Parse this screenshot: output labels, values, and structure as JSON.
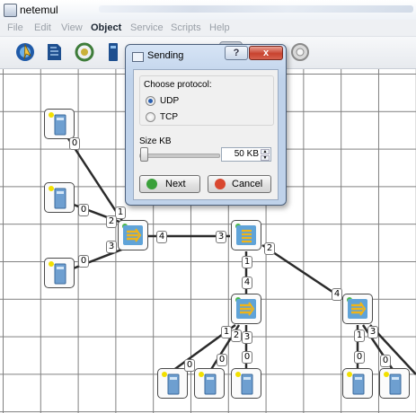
{
  "window": {
    "title": "netemul"
  },
  "menu": {
    "items": [
      {
        "label": "File",
        "active": false
      },
      {
        "label": "Edit",
        "active": false
      },
      {
        "label": "View",
        "active": false
      },
      {
        "label": "Object",
        "active": true
      },
      {
        "label": "Service",
        "active": false
      },
      {
        "label": "Scripts",
        "active": false
      },
      {
        "label": "Help",
        "active": false
      }
    ]
  },
  "toolbar": {
    "tools": [
      {
        "icon": "pointer-globe-icon"
      },
      {
        "icon": "note-icon"
      },
      {
        "icon": "cable-icon"
      },
      {
        "icon": "computer-icon"
      },
      {
        "icon": "hub-icon"
      },
      {
        "icon": "switch-icon"
      },
      {
        "icon": "router-icon"
      },
      {
        "icon": "send-icon"
      },
      {
        "icon": "delete-icon"
      },
      {
        "icon": "settings-icon"
      }
    ]
  },
  "dialog": {
    "title": "Sending",
    "help_label": "?",
    "close_label": "x",
    "protocol_label": "Choose protocol:",
    "protocols": [
      "UDP",
      "TCP"
    ],
    "selected_protocol": "UDP",
    "size_label": "Size KB",
    "size_value": "50 KB",
    "next_label": "Next",
    "cancel_label": "Cancel"
  },
  "colors": {
    "device_led_on": "#4bb84b",
    "computer_led": "#f2e000",
    "device_accent": "#f0b418",
    "device_blue": "#5fa3d8",
    "link": "#2b2b2b"
  },
  "network": {
    "port_labels": [
      "0",
      "0",
      "0",
      "1",
      "2",
      "3",
      "4",
      "3",
      "1",
      "4",
      "2",
      "4",
      "1",
      "2",
      "3",
      "0",
      "0",
      "0",
      "1",
      "0",
      "3",
      "0"
    ]
  }
}
